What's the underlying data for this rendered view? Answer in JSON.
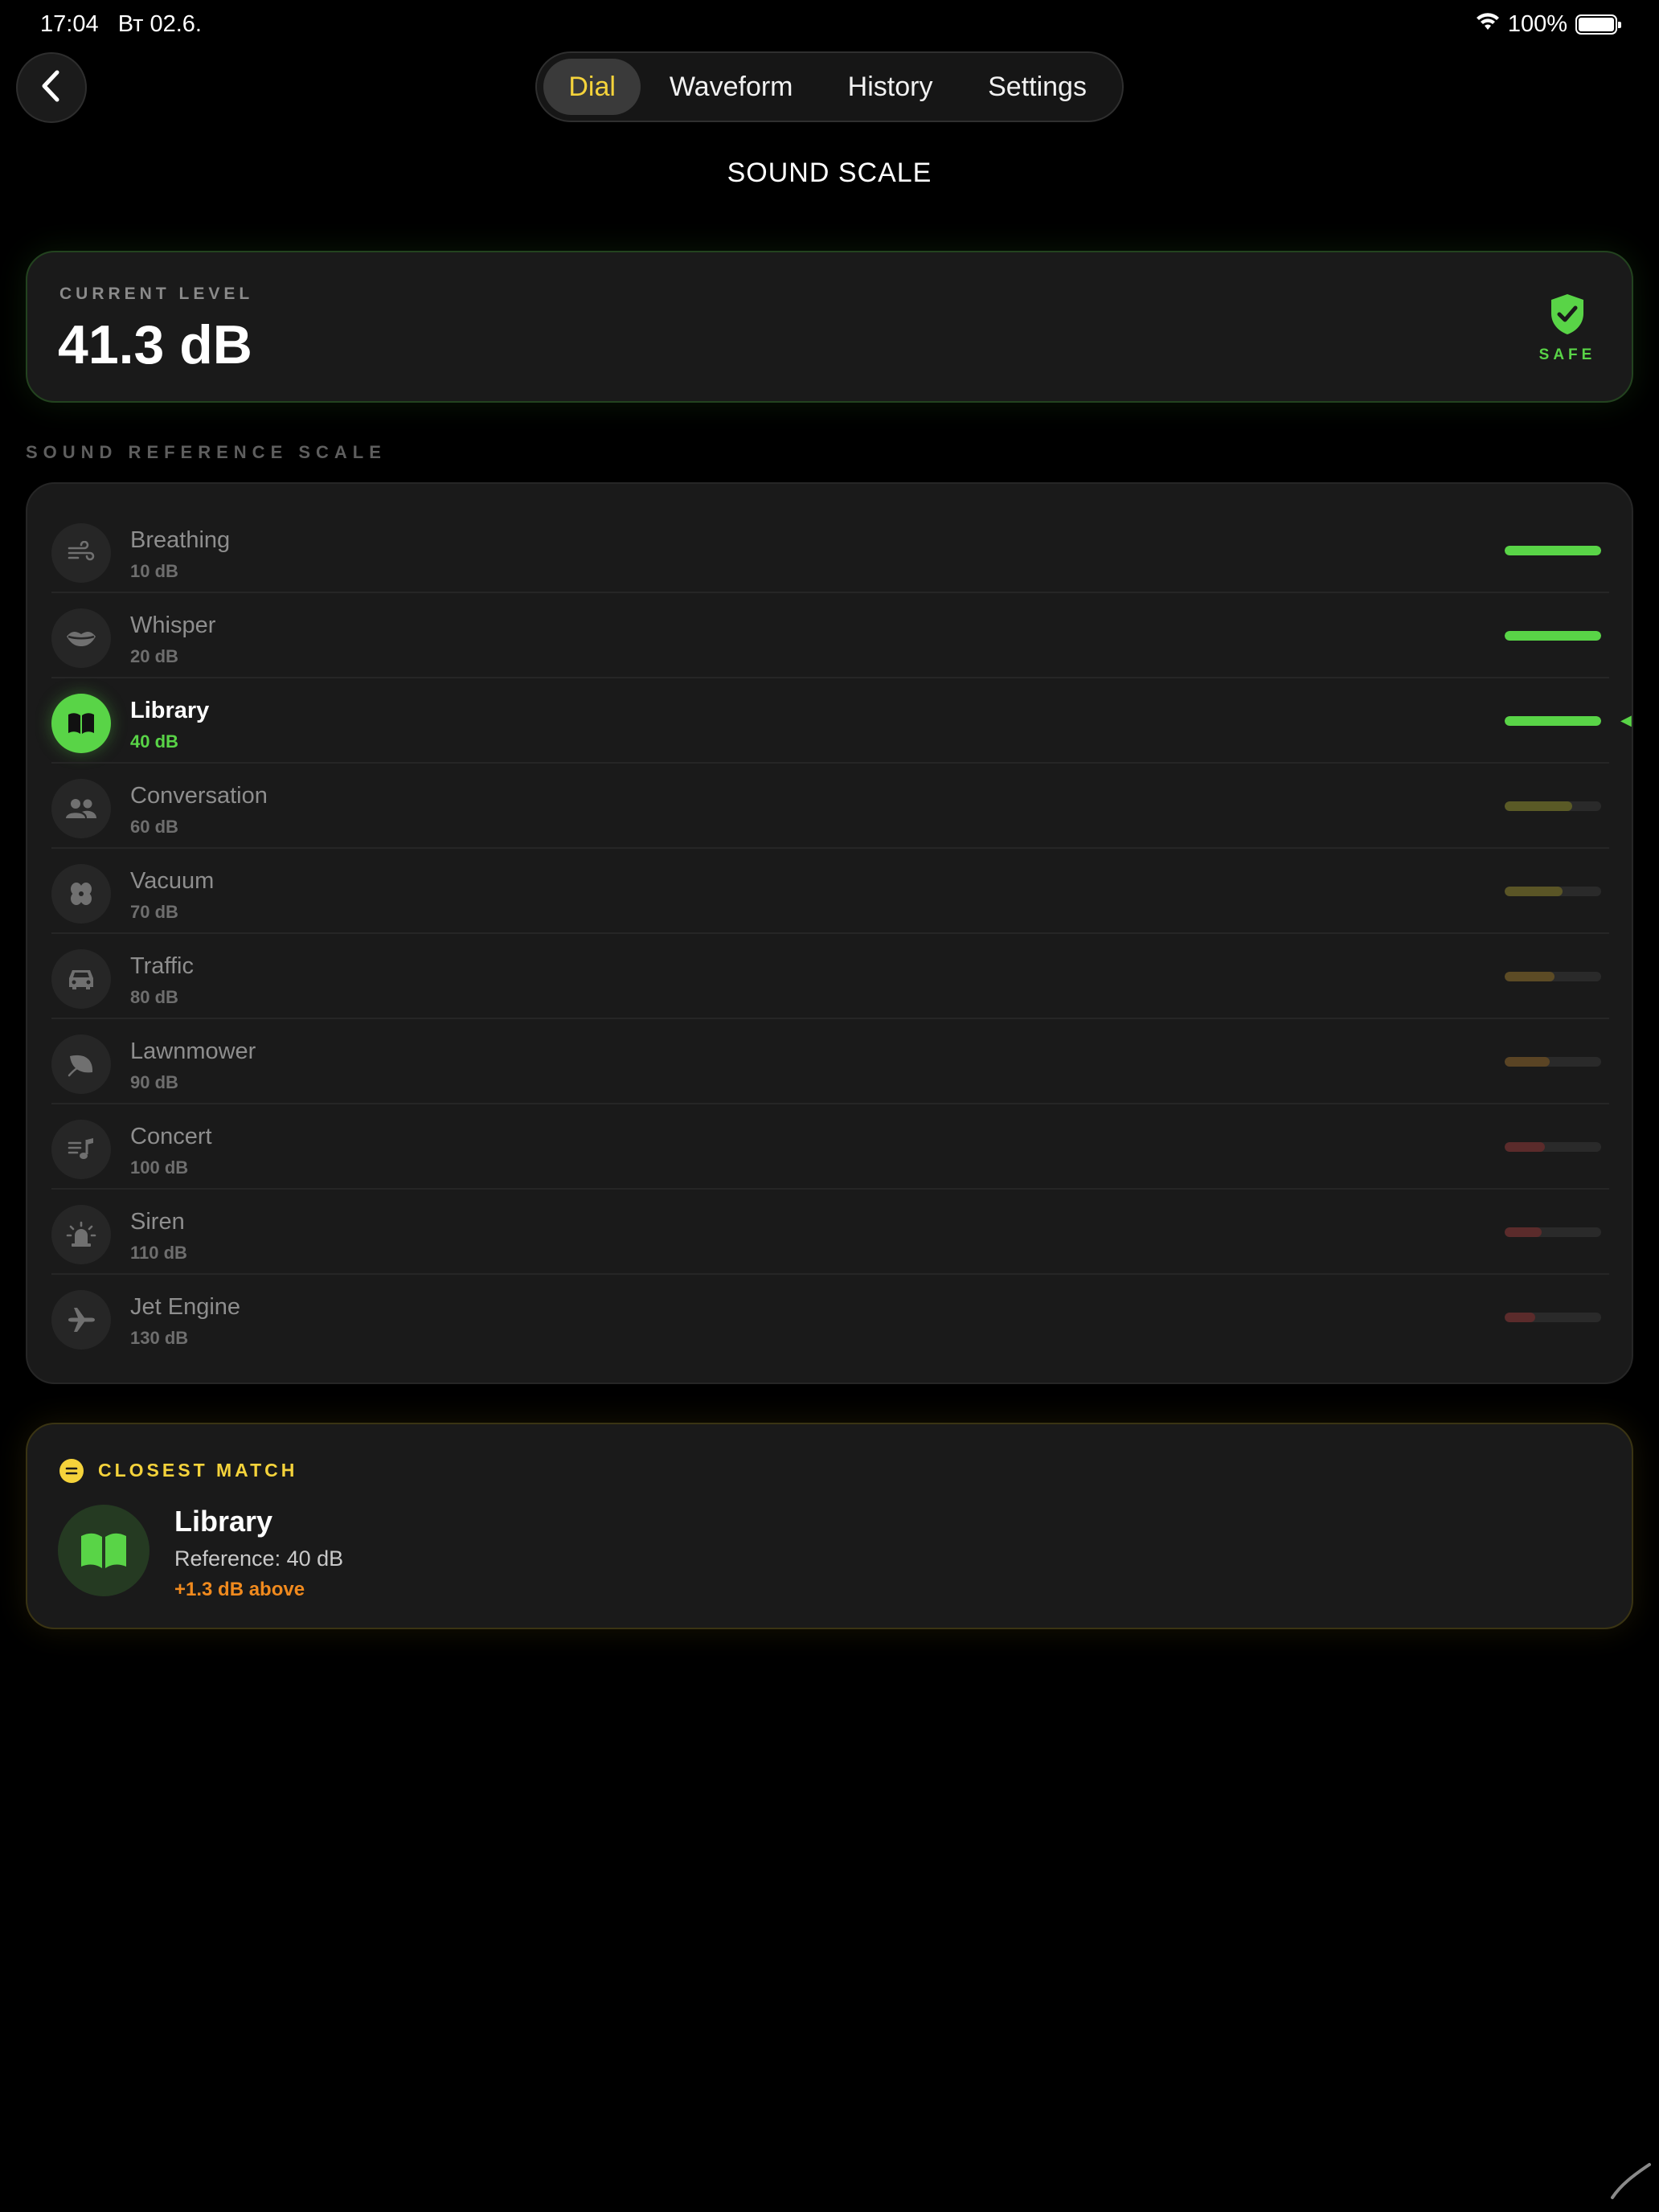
{
  "status_bar": {
    "time": "17:04",
    "date": "Вт 02.6.",
    "battery_percent": "100%",
    "battery_level": 1.0,
    "wifi_icon": "wifi-icon"
  },
  "nav": {
    "back_icon": "chevron-left-icon",
    "tabs": [
      {
        "label": "Dial",
        "active": true
      },
      {
        "label": "Waveform",
        "active": false
      },
      {
        "label": "History",
        "active": false
      },
      {
        "label": "Settings",
        "active": false
      }
    ]
  },
  "page": {
    "title": "SOUND SCALE"
  },
  "current_level": {
    "label": "CURRENT LEVEL",
    "value": "41.3 dB",
    "status": "SAFE",
    "status_icon": "shield-check-icon"
  },
  "scale": {
    "label": "SOUND REFERENCE SCALE",
    "items": [
      {
        "name": "Breathing",
        "db": "10 dB",
        "icon": "wind-icon",
        "level": 1.0,
        "color": "#59d447",
        "active": false
      },
      {
        "name": "Whisper",
        "db": "20 dB",
        "icon": "lips-icon",
        "level": 1.0,
        "color": "#59d447",
        "active": false
      },
      {
        "name": "Library",
        "db": "40 dB",
        "icon": "book-icon",
        "level": 1.0,
        "color": "#59d447",
        "active": true
      },
      {
        "name": "Conversation",
        "db": "60 dB",
        "icon": "people-icon",
        "level": 0.7,
        "color": "#5a5a26",
        "active": false
      },
      {
        "name": "Vacuum",
        "db": "70 dB",
        "icon": "fan-icon",
        "level": 0.6,
        "color": "#5a5526",
        "active": false
      },
      {
        "name": "Traffic",
        "db": "80 dB",
        "icon": "car-icon",
        "level": 0.52,
        "color": "#5c4b25",
        "active": false
      },
      {
        "name": "Lawnmower",
        "db": "90 dB",
        "icon": "leaf-icon",
        "level": 0.47,
        "color": "#5a4424",
        "active": false
      },
      {
        "name": "Concert",
        "db": "100 dB",
        "icon": "music-list-icon",
        "level": 0.42,
        "color": "#5b2b2b",
        "active": false
      },
      {
        "name": "Siren",
        "db": "110 dB",
        "icon": "siren-icon",
        "level": 0.38,
        "color": "#5b2b2b",
        "active": false
      },
      {
        "name": "Jet Engine",
        "db": "130 dB",
        "icon": "airplane-icon",
        "level": 0.32,
        "color": "#5b2b2b",
        "active": false
      }
    ]
  },
  "closest_match": {
    "label": "CLOSEST MATCH",
    "badge_icon": "equals-icon",
    "name": "Library",
    "reference": "Reference: 40 dB",
    "delta": "+1.3 dB above",
    "icon": "book-icon"
  },
  "colors": {
    "accent_green": "#59d447",
    "accent_yellow": "#f5d33b",
    "accent_orange": "#f08a1e",
    "background": "#000000",
    "card": "#1a1a1a"
  }
}
